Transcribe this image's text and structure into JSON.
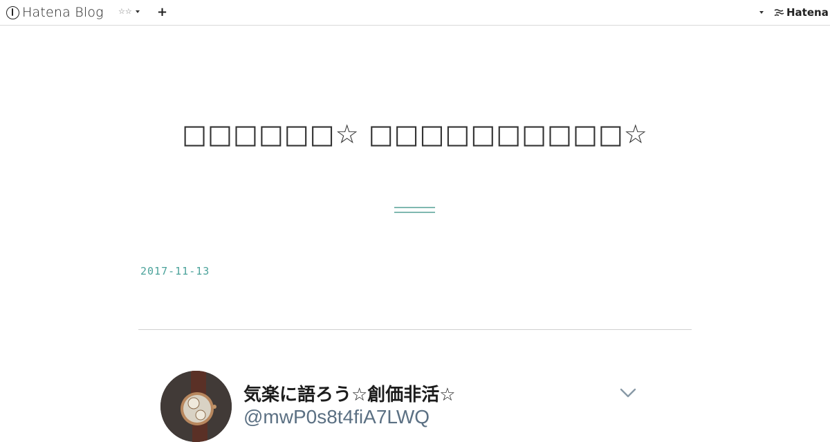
{
  "topbar": {
    "logo_text": "Hatena Blog",
    "blog_selector": "☆☆",
    "add_button": "+",
    "hatena_label": "Hatena"
  },
  "blog": {
    "title": "□□□□□□☆ □□□□□□□□□□☆",
    "entry_date": "2017-11-13"
  },
  "tweet": {
    "name": "気楽に語ろう☆創価非活☆",
    "handle": "@mwP0s8t4fiA7LWQ"
  },
  "colors": {
    "accent": "#4aa29a",
    "divider": "#cfcfcf",
    "handle": "#5b7083"
  }
}
